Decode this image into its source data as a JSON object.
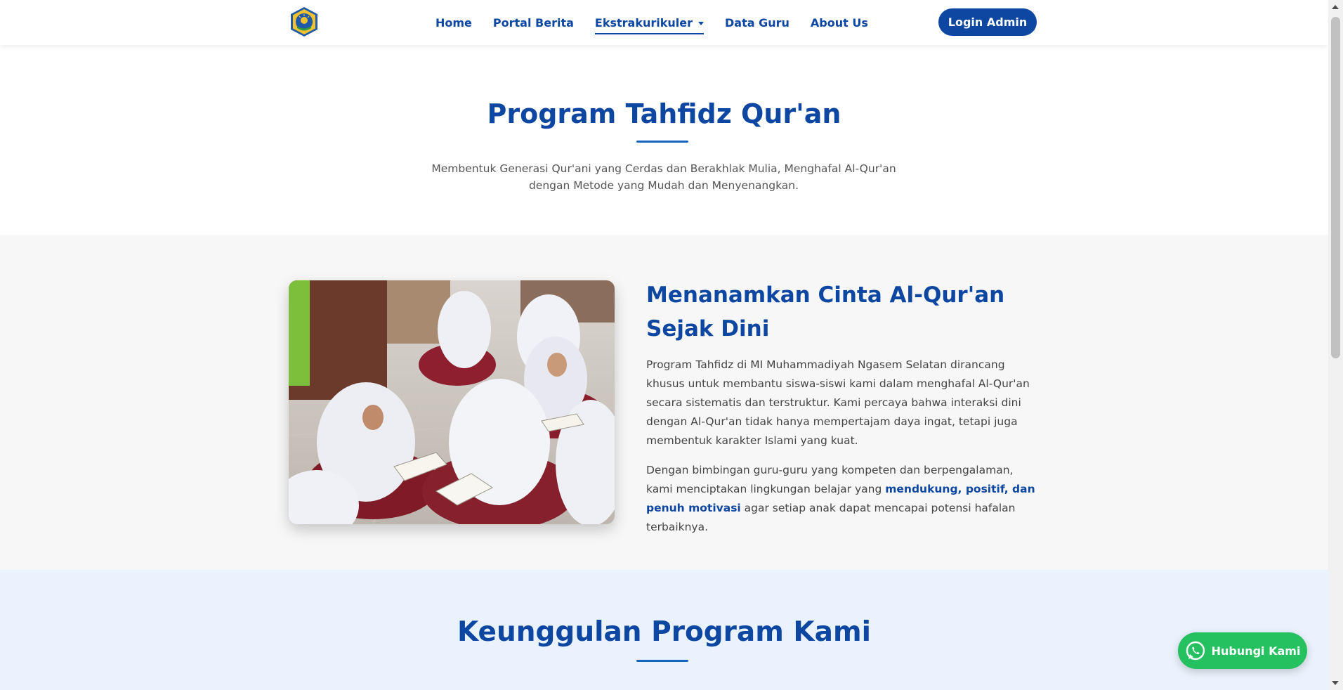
{
  "nav": {
    "logo_icon": "school-emblem-icon",
    "links": [
      "Home",
      "Portal Berita",
      "Ekstrakurikuler",
      "Data Guru",
      "About Us"
    ],
    "active_index": 2,
    "login_label": "Login Admin"
  },
  "hero": {
    "title": "Program Tahfidz Qur'an",
    "subtitle": "Membentuk Generasi Qur'ani yang Cerdas dan Berakhlak Mulia, Menghafal Al-Qur'an dengan Metode yang Mudah dan Menyenangkan."
  },
  "about": {
    "image_alt": "Siswi membaca Al-Qur'an bersama",
    "title": "Menanamkan Cinta Al-Qur'an Sejak Dini",
    "paragraph1": "Program Tahfidz di MI Muhammadiyah Ngasem Selatan dirancang khusus untuk membantu siswa-siswi kami dalam menghafal Al-Qur'an secara sistematis dan terstruktur. Kami percaya bahwa interaksi dini dengan Al-Qur'an tidak hanya mempertajam daya ingat, tetapi juga membentuk karakter Islami yang kuat.",
    "paragraph2_before": "Dengan bimbingan guru-guru yang kompeten dan berpengalaman, kami menciptakan lingkungan belajar yang ",
    "paragraph2_highlight": "mendukung, positif, dan penuh motivasi",
    "paragraph2_after": " agar setiap anak dapat mencapai potensi hafalan terbaiknya."
  },
  "advantages": {
    "title": "Keunggulan Program Kami"
  },
  "whatsapp": {
    "icon": "whatsapp-icon",
    "label": "Hubungi Kami"
  },
  "colors": {
    "primary": "#0d47a1",
    "whatsapp": "#25c060",
    "section_gray": "#f7f7f7",
    "section_blue": "#eaf3fd"
  }
}
